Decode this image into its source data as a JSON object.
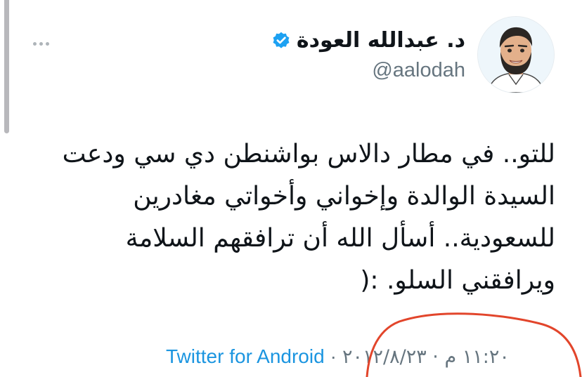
{
  "user": {
    "display_name": "د. عبدالله العودة",
    "handle": "@aalodah",
    "verified_icon": "verified-badge-icon",
    "avatar_icon": "avatar-cartoon-icon"
  },
  "more_icon": "more-options-icon",
  "tweet": {
    "lines": [
      "للتو.. في مطار دالاس بواشنطن دي سي ودعت",
      "السيدة الوالدة وإخواني وأخواتي مغادرين",
      "للسعودية.. أسأل الله أن ترافقهم السلامة",
      "ويرافقني السلو. :("
    ]
  },
  "footer": {
    "timestamp": "١١:٢٠ م · ٢٠١٢/٨/٢٣",
    "separator": "·",
    "source": "Twitter for Android"
  },
  "colors": {
    "link": "#1b95e0",
    "secondary_text": "#66757f",
    "verified": "#1da1f2",
    "annotation": "#e2452b"
  }
}
